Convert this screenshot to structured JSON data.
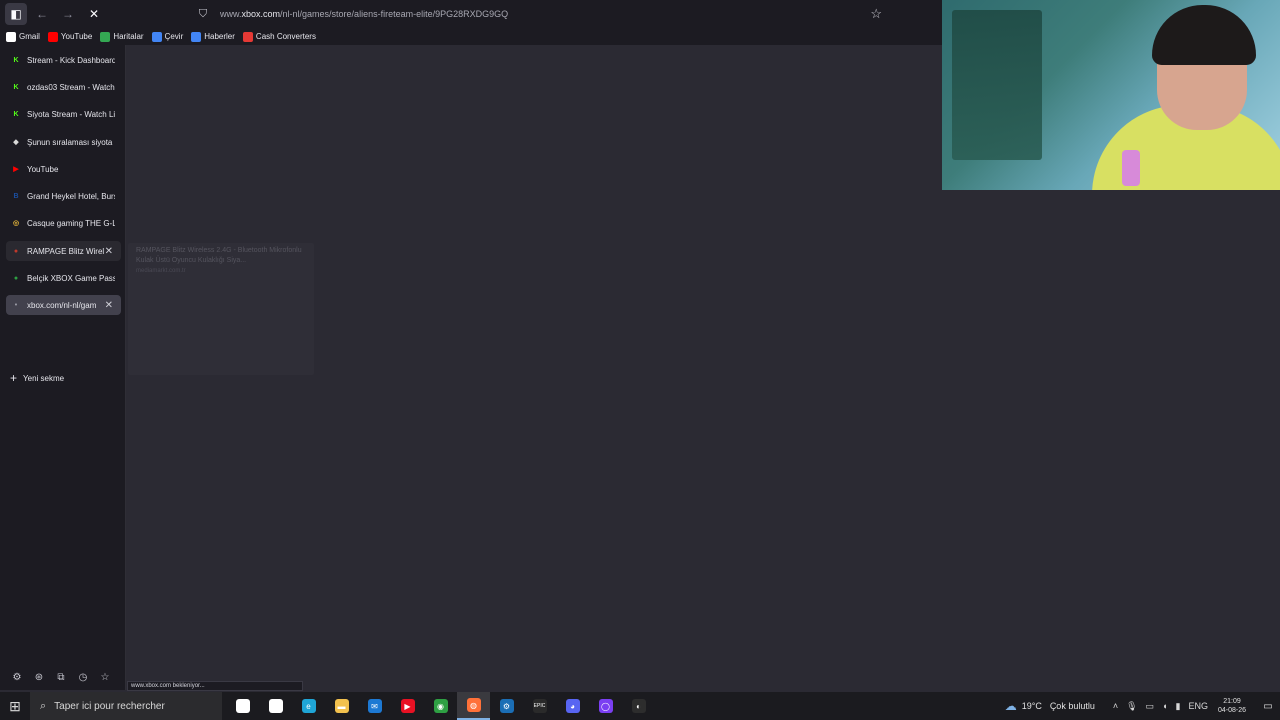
{
  "toolbar": {
    "url_prefix": "www.",
    "url_host": "xbox.com",
    "url_path": "/nl-nl/games/store/aliens-fireteam-elite/9PG28RXDG9GQ"
  },
  "bookmarks": [
    {
      "label": "Gmail",
      "color": "#ffffff"
    },
    {
      "label": "YouTube",
      "color": "#ff0000"
    },
    {
      "label": "Haritalar",
      "color": "#34a853"
    },
    {
      "label": "Çevir",
      "color": "#4285f4"
    },
    {
      "label": "Haberler",
      "color": "#4285f4"
    },
    {
      "label": "Cash Converters",
      "color": "#e53935"
    }
  ],
  "tabs": [
    {
      "label": "Stream - Kick Dashboard",
      "favicon": "K",
      "color": "#53fc18"
    },
    {
      "label": "ozdas03 Stream - Watch",
      "favicon": "K",
      "color": "#53fc18"
    },
    {
      "label": "Siyota Stream - Watch Li",
      "favicon": "K",
      "color": "#53fc18"
    },
    {
      "label": "Şunun sıralaması siyota",
      "favicon": "◆",
      "color": "#d9d9d9"
    },
    {
      "label": "YouTube",
      "favicon": "▶",
      "color": "#ff0000"
    },
    {
      "label": "Grand Heykel Hotel, Burs",
      "favicon": "B",
      "color": "#1a4ea0"
    },
    {
      "label": "Casque gaming THE G-L",
      "favicon": "◎",
      "color": "#e0b23a"
    },
    {
      "label": "RAMPAGE Blitz Wirel",
      "favicon": "●",
      "color": "#c0392b"
    },
    {
      "label": "Belçik XBOX Game Pass",
      "favicon": "●",
      "color": "#2ea043"
    },
    {
      "label": "xbox.com/nl-nl/gam",
      "favicon": "•",
      "color": "#9a9aa5"
    }
  ],
  "new_tab_label": "Yeni sekme",
  "preview": {
    "title": "RAMPAGE Blitz Wireless 2.4G - Bluetooth Mikrofonlu Kulak Üstü Oyuncu Kulaklığı Siya...",
    "domain": "mediamarkt.com.tr"
  },
  "status_text": "www.xbox.com bekleniyor...",
  "taskbar": {
    "search_placeholder": "Taper ici pour rechercher",
    "apps": [
      {
        "name": "task-view",
        "glyph": "⊞",
        "color": "#ffffff"
      },
      {
        "name": "store",
        "glyph": "▦",
        "color": "#ffffff"
      },
      {
        "name": "edge",
        "glyph": "e",
        "color": "#1fa5d6"
      },
      {
        "name": "file-explorer",
        "glyph": "▬",
        "color": "#f2c14e"
      },
      {
        "name": "mail",
        "glyph": "✉",
        "color": "#1d79d3"
      },
      {
        "name": "media",
        "glyph": "▶",
        "color": "#e81123"
      },
      {
        "name": "chrome",
        "glyph": "◉",
        "color": "#2ea043"
      },
      {
        "name": "firefox",
        "glyph": "◍",
        "color": "#ff7139"
      },
      {
        "name": "steam",
        "glyph": "⚙",
        "color": "#1b6eb5"
      },
      {
        "name": "epic-games",
        "glyph": "EPIC",
        "color": "#2a2a2a"
      },
      {
        "name": "discord",
        "glyph": "◕",
        "color": "#5865f2"
      },
      {
        "name": "app-circle",
        "glyph": "◯",
        "color": "#7b3ff2"
      },
      {
        "name": "obs",
        "glyph": "◐",
        "color": "#2d2d2d"
      }
    ],
    "weather_temp": "19°C",
    "weather_condition": "Çok bulutlu",
    "language": "ENG",
    "time": "21:09",
    "date": "04-08-26"
  }
}
